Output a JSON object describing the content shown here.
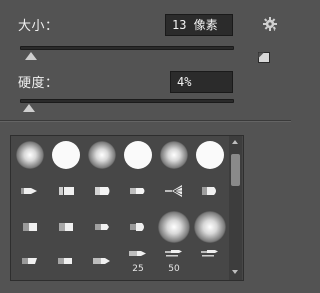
{
  "size": {
    "label": "大小：",
    "value": "13 像素",
    "slider_fraction": 0.04
  },
  "hardness": {
    "label": "硬度：",
    "value": "4%",
    "slider_fraction": 0.04
  },
  "icons": {
    "settings": "gear-icon",
    "new_preset": "new-preset-icon"
  },
  "brush_presets": {
    "row1": [
      "soft-round",
      "hard-round",
      "soft-round",
      "hard-round",
      "soft-round",
      "hard-round"
    ],
    "row2": [
      "bristle-tip",
      "bristle-tip",
      "bristle-tip",
      "bristle-tip",
      "fan-bristle",
      "bristle-tip"
    ],
    "row3": [
      "bristle-tip",
      "bristle-tip",
      "bristle-tip",
      "bristle-tip",
      "soft-round",
      "soft-round"
    ],
    "row4": [
      "erodible-tip",
      "erodible-tip",
      "airbrush-tip",
      "airbrush-tip",
      "airbrush-tip"
    ],
    "size_labels": [
      "25",
      "50"
    ]
  }
}
